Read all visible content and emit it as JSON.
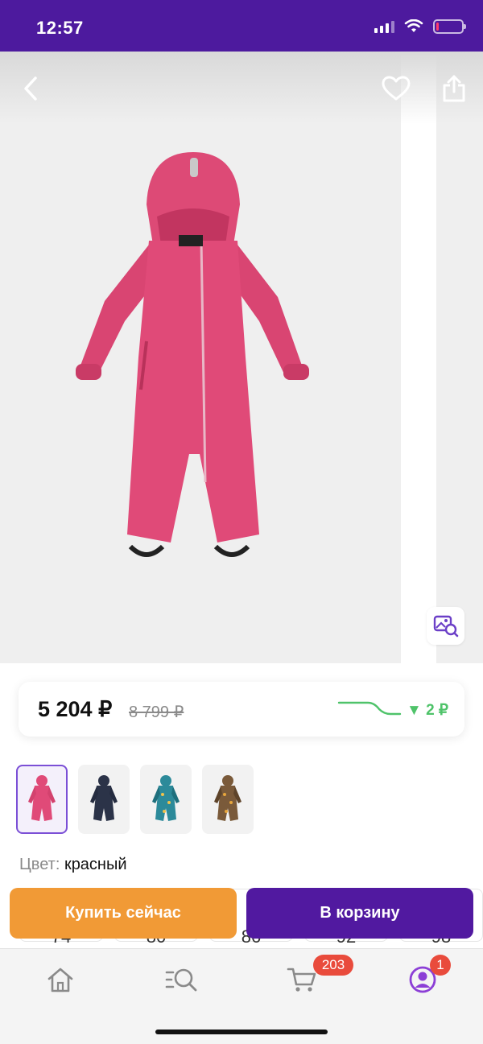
{
  "status_bar": {
    "time": "12:57",
    "icons": [
      "signal-icon",
      "wifi-icon",
      "battery-icon"
    ],
    "battery_level": 0.08
  },
  "product": {
    "image_alt": "Pink toddler winter overall"
  },
  "price": {
    "current": "5 204 ₽",
    "old": "8 799 ₽",
    "drop": "▼ 2 ₽"
  },
  "variants": [
    {
      "color": "#e04a78",
      "active": true
    },
    {
      "color": "#2b3348",
      "active": false
    },
    {
      "color": "#2c8a9a",
      "active": false
    },
    {
      "color": "#7a5a3a",
      "active": false
    }
  ],
  "color_info": {
    "label": "Цвет:",
    "value": "красный"
  },
  "sizes": [
    "74",
    "80",
    "86",
    "92",
    "98"
  ],
  "actions": {
    "buy_now": "Купить сейчас",
    "add_to_cart": "В корзину"
  },
  "nav": {
    "cart_badge": "203",
    "profile_badge": "1"
  },
  "colors": {
    "brand": "#5119a0",
    "status_bar": "#4d1a9e",
    "buy_now": "#f19a36",
    "price_drop": "#4fc36a",
    "badge": "#e94b3c"
  }
}
